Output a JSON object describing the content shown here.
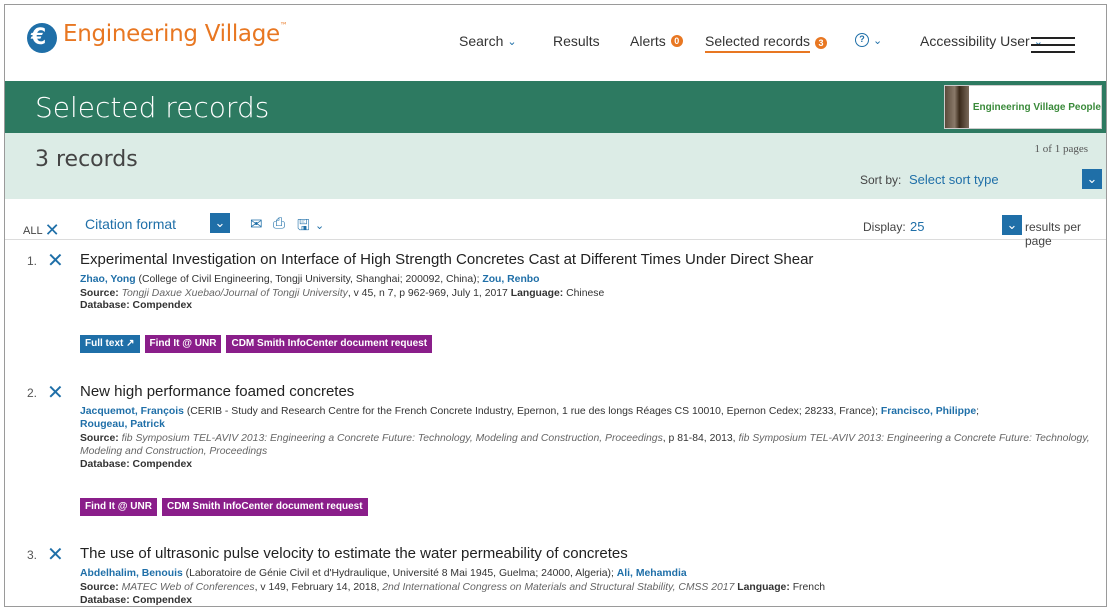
{
  "header": {
    "logo_text": "Engineering Village",
    "logo_tm": "™",
    "nav": {
      "search": "Search",
      "results": "Results",
      "alerts": "Alerts",
      "alerts_badge": "0",
      "selected": "Selected records",
      "selected_badge": "3",
      "help_icon": "?",
      "user": "Accessibility User"
    }
  },
  "title_band": {
    "title": "Selected records",
    "people_logo": "Engineering Village People"
  },
  "records_band": {
    "count": "3 records",
    "pages": "1 of 1 pages",
    "sort_label": "Sort by:",
    "sort_value": "Select sort type"
  },
  "toolbar": {
    "all": "ALL",
    "citation_format": "Citation format",
    "display_label": "Display:",
    "display_value": "25",
    "results_per_page": "results per page",
    "icons": [
      "email-icon",
      "print-icon",
      "download-icon"
    ]
  },
  "records": [
    {
      "num": "1.",
      "title": "Experimental Investigation on Interface of High Strength Concretes Cast at Different Times Under Direct Shear",
      "author1": "Zhao, Yong",
      "affil1": " (College of Civil Engineering, Tongji University, Shanghai; 200092, China); ",
      "author2": "Zou, Renbo",
      "source_label": "Source:",
      "source_it": "Tongji Daxue Xuebao/Journal of Tongji University",
      "source_rest": ", v 45, n 7, p 962-969, July 1, 2017 ",
      "language_label": "Language:",
      "language": " Chinese",
      "database_label": "Database:",
      "database": " Compendex",
      "buttons": [
        "Full text ↗",
        "Find It @ UNR",
        "CDM Smith InfoCenter document request"
      ]
    },
    {
      "num": "2.",
      "title": "New high performance foamed concretes",
      "author1": "Jacquemot, François",
      "affil1": " (CERIB - Study and Research Centre for the French Concrete Industry, Epernon, 1 rue des longs Réages CS 10010, Epernon Cedex; 28233, France); ",
      "author2": "Francisco, Philippe",
      "author2_sep": ";",
      "author3": "Rougeau, Patrick",
      "source_label": "Source:",
      "source_it1": "fib Symposium TEL-AVIV 2013: Engineering a Concrete Future: Technology, Modeling and Construction, Proceedings",
      "source_rest": ", p 81-84, 2013, ",
      "source_it2": "fib Symposium TEL-AVIV 2013: Engineering a Concrete Future: Technology, Modeling and Construction, Proceedings",
      "database_label": "Database:",
      "database": " Compendex",
      "buttons": [
        "Find It @ UNR",
        "CDM Smith InfoCenter document request"
      ]
    },
    {
      "num": "3.",
      "title": "The use of ultrasonic pulse velocity to estimate the water permeability of concretes",
      "author1": "Abdelhalim, Benouis",
      "affil1": " (Laboratoire de Génie Civil et d'Hydraulique, Université 8 Mai 1945, Guelma; 24000, Algeria); ",
      "author2": "Ali, Mehamdia",
      "source_label": "Source:",
      "source_it1": "MATEC Web of Conferences",
      "source_rest": ", v 149, February 14, 2018, ",
      "source_it2": "2nd International Congress on Materials and Structural Stability, CMSS 2017",
      "language_label": "Language:",
      "language": " French",
      "database_label": "Database:",
      "database": " Compendex"
    }
  ],
  "colors": {
    "brand_orange": "#e87722",
    "link_blue": "#1f6fa8",
    "title_green": "#2d7a61",
    "band_mint": "#dcece6",
    "button_purple": "#8a1e8a"
  }
}
